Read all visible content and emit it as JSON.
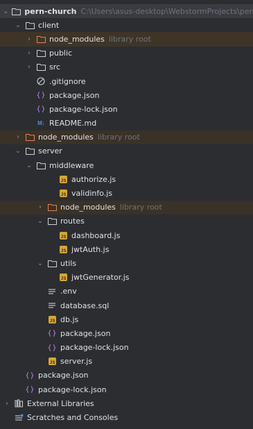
{
  "tree": {
    "root": {
      "label": "pern-church",
      "path": "C:\\Users\\asus-desktop\\WebstormProjects\\pern"
    },
    "client": {
      "label": "client"
    },
    "client_node_modules": {
      "label": "node_modules",
      "hint": "library root"
    },
    "client_public": {
      "label": "public"
    },
    "client_src": {
      "label": "src"
    },
    "client_gitignore": {
      "label": ".gitignore"
    },
    "client_package_json": {
      "label": "package.json"
    },
    "client_package_lock": {
      "label": "package-lock.json"
    },
    "client_readme": {
      "label": "README.md",
      "badge": "M↓"
    },
    "root_node_modules": {
      "label": "node_modules",
      "hint": "library root"
    },
    "server": {
      "label": "server"
    },
    "middleware": {
      "label": "middleware"
    },
    "authorize_js": {
      "label": "authorize.js"
    },
    "validinfo_js": {
      "label": "validinfo.js"
    },
    "server_node_modules": {
      "label": "node_modules",
      "hint": "library root"
    },
    "routes": {
      "label": "routes"
    },
    "dashboard_js": {
      "label": "dashboard.js"
    },
    "jwtauth_js": {
      "label": "jwtAuth.js"
    },
    "utils": {
      "label": "utils"
    },
    "jwtgenerator_js": {
      "label": "jwtGenerator.js"
    },
    "env": {
      "label": ".env"
    },
    "database_sql": {
      "label": "database.sql"
    },
    "db_js": {
      "label": "db.js"
    },
    "server_package_json": {
      "label": "package.json"
    },
    "server_package_lock": {
      "label": "package-lock.json"
    },
    "server_js": {
      "label": "server.js"
    },
    "root_package_json": {
      "label": "package.json"
    },
    "root_package_lock": {
      "label": "package-lock.json"
    },
    "external_libraries": {
      "label": "External Libraries"
    },
    "scratches": {
      "label": "Scratches and Consoles"
    }
  },
  "js_badge_text": "JS",
  "colors": {
    "background": "#2b2d30",
    "folder": "#cfd1d6",
    "excluded_folder": "#e0855a",
    "json_icon": "#b078e0",
    "js_icon": "#d8a636",
    "hint_text": "#6f737a"
  }
}
